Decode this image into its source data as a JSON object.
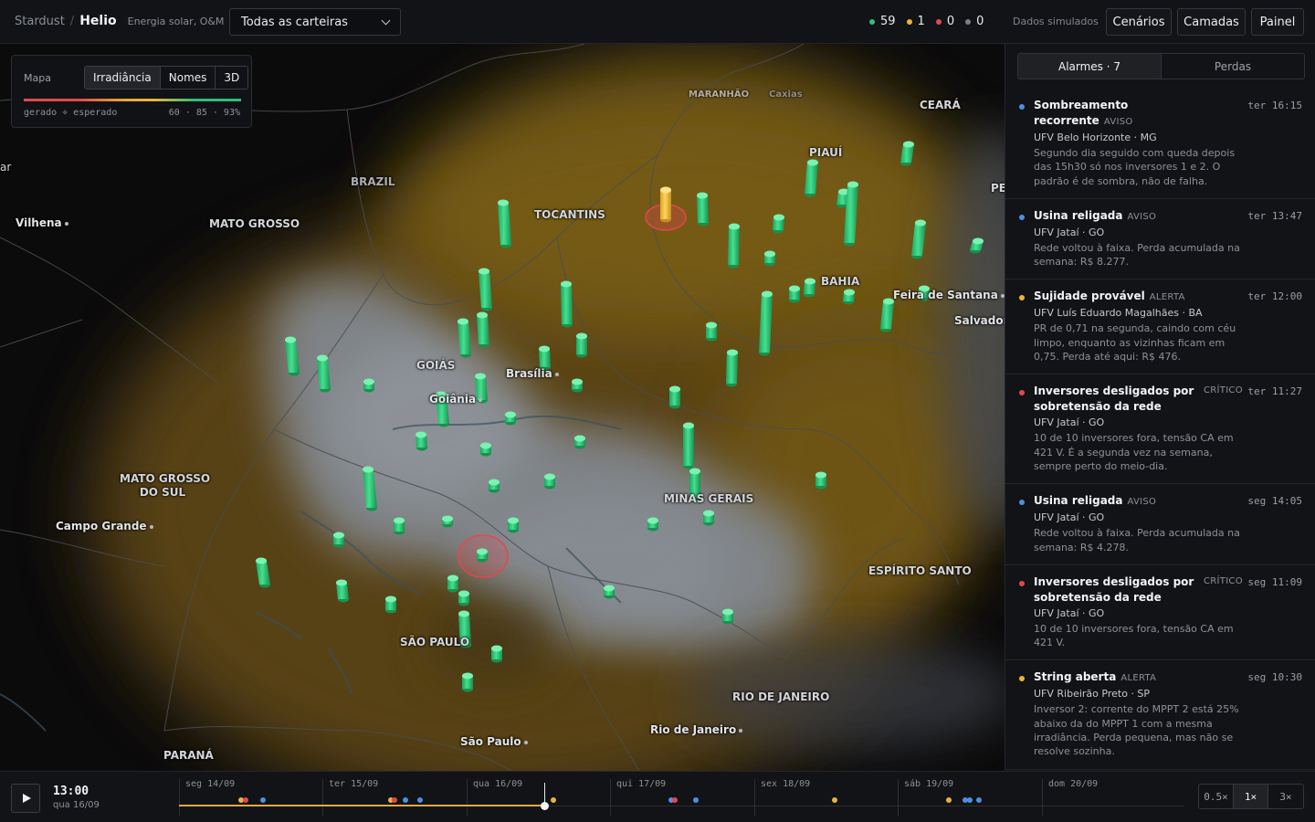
{
  "app": {
    "org": "Stardust",
    "sep": "/",
    "name": "Helio",
    "subtitle": "Energia solar, O&M"
  },
  "portfolio_select": {
    "value": "Todas as carteiras"
  },
  "status_counts": [
    {
      "value": "59",
      "color": "#2fbf79"
    },
    {
      "value": "1",
      "color": "#e9b43a"
    },
    {
      "value": "0",
      "color": "#e2484c"
    },
    {
      "value": "0",
      "color": "#7b8088"
    }
  ],
  "sim_label": "Dados simulados",
  "top_buttons": {
    "scenarios": "Cenários",
    "layers": "Camadas",
    "panel": "Painel"
  },
  "map_legend": {
    "title": "Mapa",
    "modes": [
      "Irradiância",
      "Nomes",
      "3D"
    ],
    "active_mode": "Irradiância",
    "caption": "gerado ÷ esperado",
    "thresholds": "60 · 85 · 93%"
  },
  "map_labels": {
    "brazil": "BRAZIL",
    "mato_grosso": "MATO GROSSO",
    "tocantins": "TOCANTINS",
    "ceara": "CEARÁ",
    "piaui": "PIAUÍ",
    "pe": "PE",
    "bahia": "BAHIA",
    "feira": "Feira de Santana",
    "salvador": "Salvador",
    "goias": "GOIÁS",
    "brasilia": "Brasília",
    "goiania": "Goiânia",
    "mgs1": "MATO GROSSO",
    "mgs2": "DO SUL",
    "campo_grande": "Campo Grande",
    "minas": "MINAS GERAIS",
    "espirito": "ESPÍRITO SANTO",
    "sao_paulo_state": "SÃO PAULO",
    "sao_paulo": "São Paulo",
    "rio_state": "RIO DE JANEIRO",
    "rio": "Rio de Janeiro",
    "parana": "PARANÁ",
    "vilhena": "Vilhena",
    "ar": "ar",
    "top_a": "MARANHÃO",
    "top_b": "Caxias"
  },
  "panel": {
    "tabs": [
      "Alarmes · 7",
      "Perdas"
    ],
    "alarms": [
      {
        "title": "Sombreamento recorrente",
        "severity": "AVISO",
        "color": "#4f8fe0",
        "time": "ter 16:15",
        "plant": "UFV Belo Horizonte · MG",
        "desc": "Segundo dia seguido com queda depois das 15h30 só nos inversores 1 e 2. O padrão é de sombra, não de falha."
      },
      {
        "title": "Usina religada",
        "severity": "AVISO",
        "color": "#4f8fe0",
        "time": "ter 13:47",
        "plant": "UFV Jataí · GO",
        "desc": "Rede voltou à faixa. Perda acumulada na semana: R$ 8.277."
      },
      {
        "title": "Sujidade provável",
        "severity": "ALERTA",
        "color": "#e9b43a",
        "time": "ter 12:00",
        "plant": "UFV Luís Eduardo Magalhães · BA",
        "desc": "PR de 0,71 na segunda, caindo com céu limpo, enquanto as vizinhas ficam em 0,75. Perda até aqui: R$ 476."
      },
      {
        "title": "Inversores desligados por sobretensão da rede",
        "severity": "CRÍTICO",
        "color": "#e2484c",
        "time": "ter 11:27",
        "plant": "UFV Jataí · GO",
        "desc": "10 de 10 inversores fora, tensão CA em 421 V. É a segunda vez na semana, sempre perto do meio-dia."
      },
      {
        "title": "Usina religada",
        "severity": "AVISO",
        "color": "#4f8fe0",
        "time": "seg 14:05",
        "plant": "UFV Jataí · GO",
        "desc": "Rede voltou à faixa. Perda acumulada na semana: R$ 4.278."
      },
      {
        "title": "Inversores desligados por sobretensão da rede",
        "severity": "CRÍTICO",
        "color": "#e2484c",
        "time": "seg 11:09",
        "plant": "UFV Jataí · GO",
        "desc": "10 de 10 inversores fora, tensão CA em 421 V."
      },
      {
        "title": "String aberta",
        "severity": "ALERTA",
        "color": "#e9b43a",
        "time": "seg 10:30",
        "plant": "UFV Ribeirão Preto · SP",
        "desc": "Inversor 2: corrente do MPPT 2 está 25% abaixo da do MPPT 1 com a mesma irradiância. Perda pequena, mas não se resolve sozinha."
      }
    ]
  },
  "timeline": {
    "time": "13:00",
    "date": "qua 16/09",
    "days": [
      "seg 14/09",
      "ter 15/09",
      "qua 16/09",
      "qui 17/09",
      "sex 18/09",
      "sáb 19/09",
      "dom 20/09"
    ],
    "speeds": [
      "0.5×",
      "1×",
      "3×"
    ],
    "active_speed": "1×"
  }
}
